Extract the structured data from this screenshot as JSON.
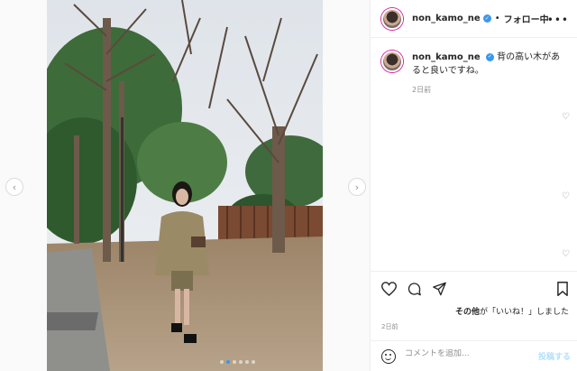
{
  "post": {
    "username": "non_kamo_ne",
    "follow_status": "フォロー中",
    "separator": "•",
    "more": "•••"
  },
  "comment": {
    "username": "non_kamo_ne",
    "text": "背の高い木があると良いですね。",
    "time": "2日前"
  },
  "likes": {
    "prefix": "その他",
    "suffix": "が「いいね！」しました"
  },
  "post_time": "2日前",
  "comment_bar": {
    "placeholder": "コメントを追加...",
    "post_label": "投稿する"
  },
  "icons": {
    "prev": "chevron-left",
    "next": "chevron-right",
    "like": "heart",
    "comment": "speech-bubble",
    "share": "paper-plane",
    "save": "bookmark",
    "emoji": "smiley"
  },
  "carousel": {
    "slides": 6,
    "active": 1
  },
  "colors": {
    "accent": "#3897f0",
    "post_disabled": "#b2dffc"
  }
}
